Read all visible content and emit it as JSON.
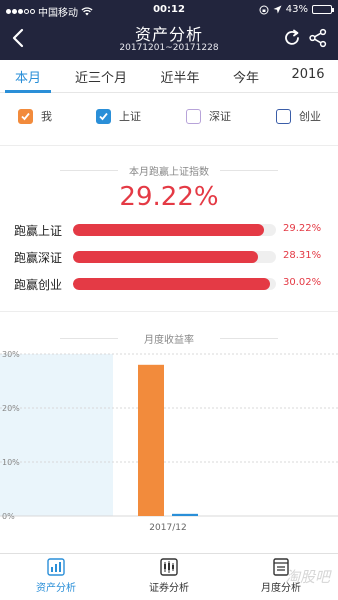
{
  "status_bar": {
    "carrier": "中国移动",
    "time": "00:12",
    "battery": "43%",
    "battery_level": 0.43
  },
  "header": {
    "title": "资产分析",
    "date_range": "20171201~20171228"
  },
  "tabs": [
    {
      "label": "本月",
      "active": true
    },
    {
      "label": "近三个月",
      "active": false
    },
    {
      "label": "近半年",
      "active": false
    },
    {
      "label": "今年",
      "active": false
    },
    {
      "label": "2016",
      "active": false
    }
  ],
  "filters": [
    {
      "label": "我",
      "checked": true,
      "color": "#f28b3c"
    },
    {
      "label": "上证",
      "checked": true,
      "color": "#2a8fd8"
    },
    {
      "label": "深证",
      "checked": false,
      "color": "#b7a3d9"
    },
    {
      "label": "创业",
      "checked": false,
      "color": "#3a5da8"
    }
  ],
  "summary": {
    "title": "本月跑赢上证指数",
    "value": "29.22%",
    "rows": [
      {
        "label": "跑赢上证",
        "value": "29.22%",
        "pct": 29.22
      },
      {
        "label": "跑赢深证",
        "value": "28.31%",
        "pct": 28.31
      },
      {
        "label": "跑赢创业",
        "value": "30.02%",
        "pct": 30.02
      }
    ]
  },
  "chart_title": "月度收益率",
  "chart_data": {
    "type": "bar",
    "categories": [
      "2017/12"
    ],
    "series": [
      {
        "values": [
          28.0
        ],
        "color": "#f28b3c"
      },
      {
        "values": [
          0.4
        ],
        "color": "#2a8fd8"
      }
    ],
    "ylim": [
      0,
      30
    ],
    "yticks": [
      "30%",
      "20%",
      "10%",
      "0%"
    ],
    "grid": true
  },
  "footer": [
    {
      "label": "资产分析",
      "active": true,
      "icon": "bar-chart-icon"
    },
    {
      "label": "证券分析",
      "active": false,
      "icon": "candlestick-icon"
    },
    {
      "label": "月度分析",
      "active": false,
      "icon": "calendar-doc-icon"
    }
  ],
  "watermark": "淘股吧"
}
